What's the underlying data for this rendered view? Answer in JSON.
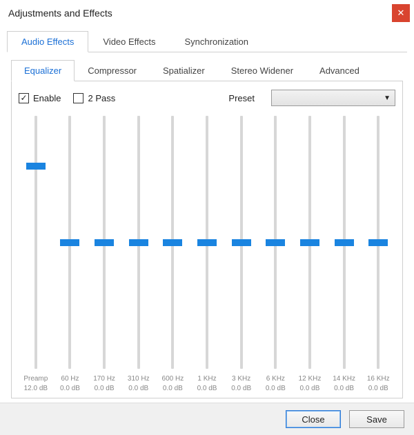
{
  "window": {
    "title": "Adjustments and Effects"
  },
  "tabs": {
    "audio": "Audio Effects",
    "video": "Video Effects",
    "sync": "Synchronization"
  },
  "subtabs": {
    "equalizer": "Equalizer",
    "compressor": "Compressor",
    "spatializer": "Spatializer",
    "stereo": "Stereo Widener",
    "advanced": "Advanced"
  },
  "equalizer": {
    "enable_label": "Enable",
    "enable_checked": true,
    "twopass_label": "2 Pass",
    "twopass_checked": false,
    "preset_label": "Preset",
    "preset_value": ""
  },
  "preamp": {
    "label": "Preamp",
    "value_text": "12.0 dB",
    "thumb_percent": 20
  },
  "bands": [
    {
      "freq": "60 Hz",
      "value_text": "0.0 dB",
      "thumb_percent": 50
    },
    {
      "freq": "170 Hz",
      "value_text": "0.0 dB",
      "thumb_percent": 50
    },
    {
      "freq": "310 Hz",
      "value_text": "0.0 dB",
      "thumb_percent": 50
    },
    {
      "freq": "600 Hz",
      "value_text": "0.0 dB",
      "thumb_percent": 50
    },
    {
      "freq": "1 KHz",
      "value_text": "0.0 dB",
      "thumb_percent": 50
    },
    {
      "freq": "3 KHz",
      "value_text": "0.0 dB",
      "thumb_percent": 50
    },
    {
      "freq": "6 KHz",
      "value_text": "0.0 dB",
      "thumb_percent": 50
    },
    {
      "freq": "12 KHz",
      "value_text": "0.0 dB",
      "thumb_percent": 50
    },
    {
      "freq": "14 KHz",
      "value_text": "0.0 dB",
      "thumb_percent": 50
    },
    {
      "freq": "16 KHz",
      "value_text": "0.0 dB",
      "thumb_percent": 50
    }
  ],
  "footer": {
    "close": "Close",
    "save": "Save"
  },
  "colors": {
    "accent": "#1a84e0",
    "close_btn": "#d9442f",
    "active_tab_text": "#1a6fd6"
  }
}
